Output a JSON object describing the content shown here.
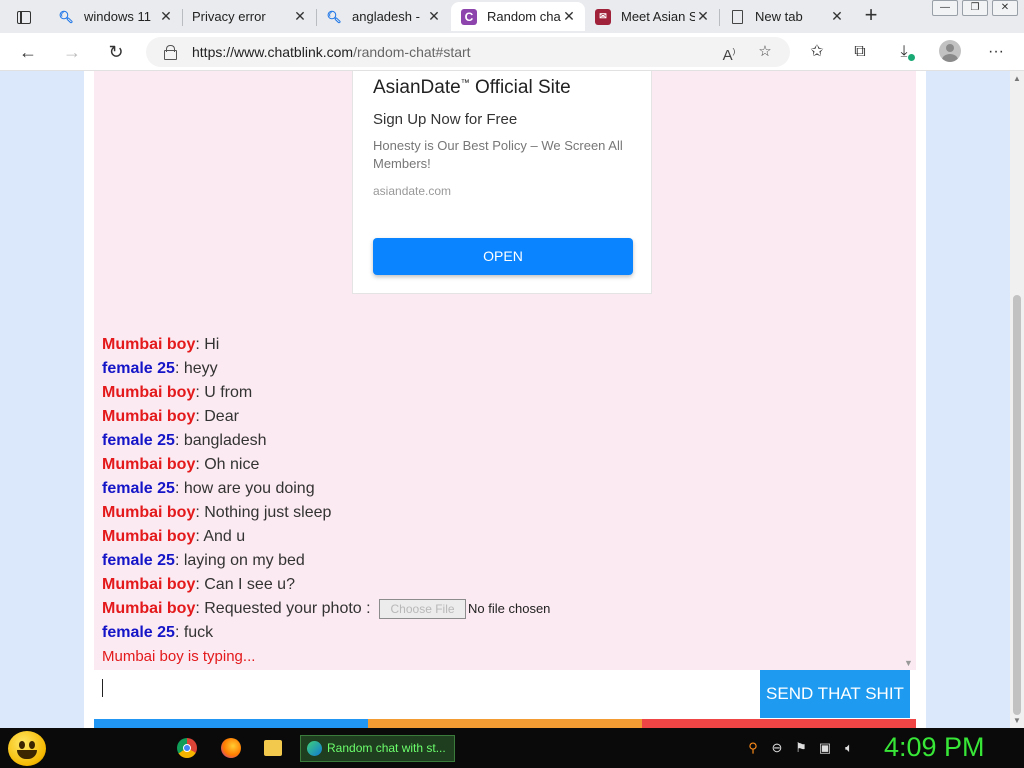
{
  "tabs": [
    {
      "label": "windows 11",
      "icon": "search-icon",
      "active": false
    },
    {
      "label": "Privacy error",
      "icon": "none",
      "active": false
    },
    {
      "label": "angladesh -",
      "icon": "search-icon",
      "active": false
    },
    {
      "label": "Random cha",
      "icon": "chatblink-icon",
      "active": true
    },
    {
      "label": "Meet Asian S",
      "icon": "asiandate-icon",
      "active": false
    },
    {
      "label": "New tab",
      "icon": "page-icon",
      "active": false
    }
  ],
  "address": {
    "url_host": "https://www.chatblink.com",
    "url_path": "/random-chat#start"
  },
  "ad": {
    "title": "AsianDate",
    "tm": "™",
    "title_suffix": " Official Site",
    "subtitle": "Sign Up Now for Free",
    "description": "Honesty is Our Best Policy – We Screen All Members!",
    "domain": "asiandate.com",
    "button": "OPEN"
  },
  "messages": [
    {
      "who": "Mumbai boy",
      "role": "stranger",
      "text": ": Hi"
    },
    {
      "who": "female 25",
      "role": "you",
      "text": ": heyy"
    },
    {
      "who": "Mumbai boy",
      "role": "stranger",
      "text": ": U from"
    },
    {
      "who": "Mumbai boy",
      "role": "stranger",
      "text": ": Dear"
    },
    {
      "who": "female 25",
      "role": "you",
      "text": ": bangladesh"
    },
    {
      "who": "Mumbai boy",
      "role": "stranger",
      "text": ": Oh nice"
    },
    {
      "who": "female 25",
      "role": "you",
      "text": ": how are you doing"
    },
    {
      "who": "Mumbai boy",
      "role": "stranger",
      "text": ": Nothing just sleep"
    },
    {
      "who": "Mumbai boy",
      "role": "stranger",
      "text": ": And u"
    },
    {
      "who": "female 25",
      "role": "you",
      "text": ": laying on my bed"
    },
    {
      "who": "Mumbai boy",
      "role": "stranger",
      "text": ": Can I see u?"
    },
    {
      "who": "Mumbai boy",
      "role": "stranger",
      "text": ": Requested your photo :",
      "file_button": "Choose File",
      "file_status": "No file chosen"
    },
    {
      "who": "female 25",
      "role": "you",
      "text": ": fuck"
    }
  ],
  "typing_indicator": "Mumbai boy is typing...",
  "input": {
    "value": "",
    "send_label": "SEND THAT SHIT"
  },
  "strip_colors": [
    "#2196f3",
    "#f39c34",
    "#ef4545"
  ],
  "colors": {
    "stranger": "#e3191b",
    "you": "#1515c8",
    "accent": "#1e9bf0"
  },
  "taskbar": {
    "task_label": "Random chat with st...",
    "clock": "4:09 PM"
  }
}
